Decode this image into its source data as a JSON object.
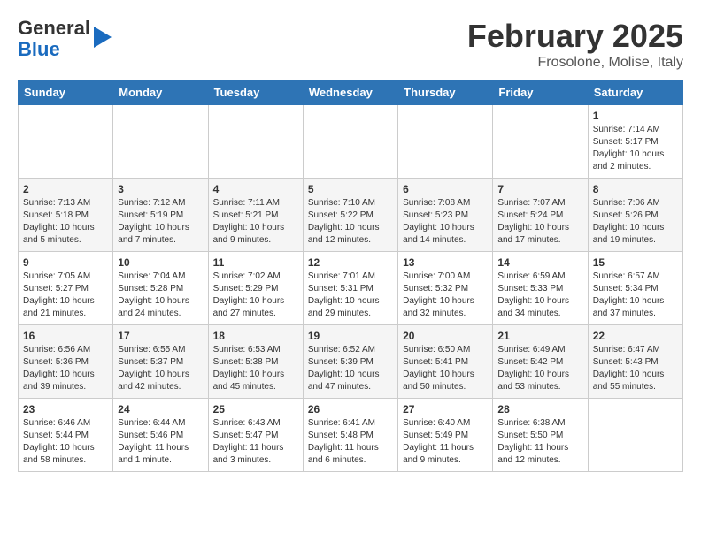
{
  "logo": {
    "general": "General",
    "blue": "Blue"
  },
  "header": {
    "month": "February 2025",
    "location": "Frosolone, Molise, Italy"
  },
  "weekdays": [
    "Sunday",
    "Monday",
    "Tuesday",
    "Wednesday",
    "Thursday",
    "Friday",
    "Saturday"
  ],
  "weeks": [
    [
      {
        "day": "",
        "info": ""
      },
      {
        "day": "",
        "info": ""
      },
      {
        "day": "",
        "info": ""
      },
      {
        "day": "",
        "info": ""
      },
      {
        "day": "",
        "info": ""
      },
      {
        "day": "",
        "info": ""
      },
      {
        "day": "1",
        "info": "Sunrise: 7:14 AM\nSunset: 5:17 PM\nDaylight: 10 hours and 2 minutes."
      }
    ],
    [
      {
        "day": "2",
        "info": "Sunrise: 7:13 AM\nSunset: 5:18 PM\nDaylight: 10 hours and 5 minutes."
      },
      {
        "day": "3",
        "info": "Sunrise: 7:12 AM\nSunset: 5:19 PM\nDaylight: 10 hours and 7 minutes."
      },
      {
        "day": "4",
        "info": "Sunrise: 7:11 AM\nSunset: 5:21 PM\nDaylight: 10 hours and 9 minutes."
      },
      {
        "day": "5",
        "info": "Sunrise: 7:10 AM\nSunset: 5:22 PM\nDaylight: 10 hours and 12 minutes."
      },
      {
        "day": "6",
        "info": "Sunrise: 7:08 AM\nSunset: 5:23 PM\nDaylight: 10 hours and 14 minutes."
      },
      {
        "day": "7",
        "info": "Sunrise: 7:07 AM\nSunset: 5:24 PM\nDaylight: 10 hours and 17 minutes."
      },
      {
        "day": "8",
        "info": "Sunrise: 7:06 AM\nSunset: 5:26 PM\nDaylight: 10 hours and 19 minutes."
      }
    ],
    [
      {
        "day": "9",
        "info": "Sunrise: 7:05 AM\nSunset: 5:27 PM\nDaylight: 10 hours and 21 minutes."
      },
      {
        "day": "10",
        "info": "Sunrise: 7:04 AM\nSunset: 5:28 PM\nDaylight: 10 hours and 24 minutes."
      },
      {
        "day": "11",
        "info": "Sunrise: 7:02 AM\nSunset: 5:29 PM\nDaylight: 10 hours and 27 minutes."
      },
      {
        "day": "12",
        "info": "Sunrise: 7:01 AM\nSunset: 5:31 PM\nDaylight: 10 hours and 29 minutes."
      },
      {
        "day": "13",
        "info": "Sunrise: 7:00 AM\nSunset: 5:32 PM\nDaylight: 10 hours and 32 minutes."
      },
      {
        "day": "14",
        "info": "Sunrise: 6:59 AM\nSunset: 5:33 PM\nDaylight: 10 hours and 34 minutes."
      },
      {
        "day": "15",
        "info": "Sunrise: 6:57 AM\nSunset: 5:34 PM\nDaylight: 10 hours and 37 minutes."
      }
    ],
    [
      {
        "day": "16",
        "info": "Sunrise: 6:56 AM\nSunset: 5:36 PM\nDaylight: 10 hours and 39 minutes."
      },
      {
        "day": "17",
        "info": "Sunrise: 6:55 AM\nSunset: 5:37 PM\nDaylight: 10 hours and 42 minutes."
      },
      {
        "day": "18",
        "info": "Sunrise: 6:53 AM\nSunset: 5:38 PM\nDaylight: 10 hours and 45 minutes."
      },
      {
        "day": "19",
        "info": "Sunrise: 6:52 AM\nSunset: 5:39 PM\nDaylight: 10 hours and 47 minutes."
      },
      {
        "day": "20",
        "info": "Sunrise: 6:50 AM\nSunset: 5:41 PM\nDaylight: 10 hours and 50 minutes."
      },
      {
        "day": "21",
        "info": "Sunrise: 6:49 AM\nSunset: 5:42 PM\nDaylight: 10 hours and 53 minutes."
      },
      {
        "day": "22",
        "info": "Sunrise: 6:47 AM\nSunset: 5:43 PM\nDaylight: 10 hours and 55 minutes."
      }
    ],
    [
      {
        "day": "23",
        "info": "Sunrise: 6:46 AM\nSunset: 5:44 PM\nDaylight: 10 hours and 58 minutes."
      },
      {
        "day": "24",
        "info": "Sunrise: 6:44 AM\nSunset: 5:46 PM\nDaylight: 11 hours and 1 minute."
      },
      {
        "day": "25",
        "info": "Sunrise: 6:43 AM\nSunset: 5:47 PM\nDaylight: 11 hours and 3 minutes."
      },
      {
        "day": "26",
        "info": "Sunrise: 6:41 AM\nSunset: 5:48 PM\nDaylight: 11 hours and 6 minutes."
      },
      {
        "day": "27",
        "info": "Sunrise: 6:40 AM\nSunset: 5:49 PM\nDaylight: 11 hours and 9 minutes."
      },
      {
        "day": "28",
        "info": "Sunrise: 6:38 AM\nSunset: 5:50 PM\nDaylight: 11 hours and 12 minutes."
      },
      {
        "day": "",
        "info": ""
      }
    ]
  ]
}
